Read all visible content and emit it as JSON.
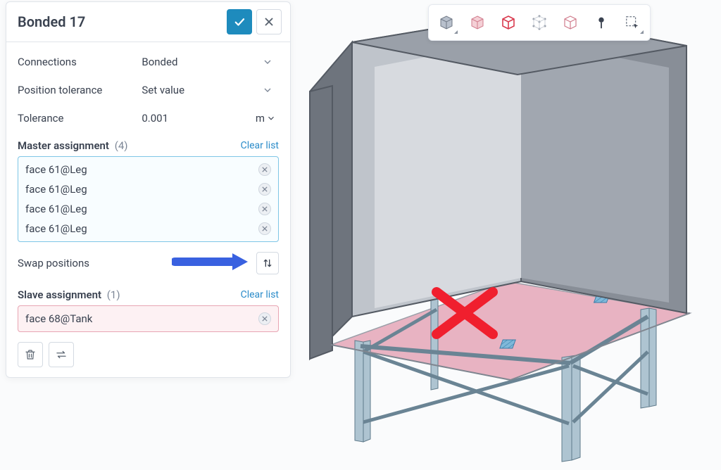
{
  "panel": {
    "title": "Bonded 17",
    "rows": {
      "connections": {
        "label": "Connections",
        "value": "Bonded"
      },
      "position_tolerance": {
        "label": "Position tolerance",
        "value": "Set value"
      },
      "tolerance": {
        "label": "Tolerance",
        "value": "0.001",
        "unit": "m"
      }
    },
    "master": {
      "label": "Master assignment",
      "count": "(4)",
      "clear": "Clear list",
      "items": [
        "face 61@Leg",
        "face 61@Leg",
        "face 61@Leg",
        "face 61@Leg"
      ]
    },
    "swap": {
      "label": "Swap positions"
    },
    "slave": {
      "label": "Slave assignment",
      "count": "(1)",
      "clear": "Clear list",
      "items": [
        "face 68@Tank"
      ]
    }
  },
  "toolbar": {
    "items": [
      {
        "name": "view-solid-icon"
      },
      {
        "name": "view-surface-icon"
      },
      {
        "name": "view-edges-icon"
      },
      {
        "name": "view-nodes-icon"
      },
      {
        "name": "view-wire-icon"
      },
      {
        "name": "probe-icon"
      },
      {
        "name": "box-select-icon"
      }
    ],
    "active_index": 2
  },
  "colors": {
    "accent": "#1e8bbd",
    "link": "#2a8bc9",
    "masterBorder": "#7fc6e6",
    "slaveBorder": "#e8a5b3",
    "annotation": "#3961e0",
    "errorX": "#f01f2e"
  }
}
